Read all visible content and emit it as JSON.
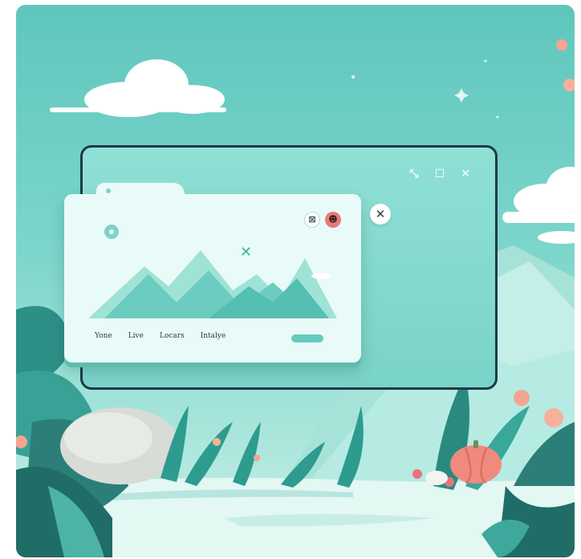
{
  "window": {
    "controls": {
      "minimize_icon": "arrow-collapse-icon",
      "maximize_icon": "square-icon",
      "close_icon": "close-icon",
      "minimize_glyph": "⤡",
      "maximize_glyph": "☐",
      "close_glyph": "✕"
    }
  },
  "card": {
    "nav": [
      "Yone",
      "Live",
      "Locars",
      "Intalye"
    ],
    "minimize_glyph": "⊠",
    "profile_glyph": "☻",
    "close_glyph": "✕",
    "x_glyph": "✕"
  },
  "colors": {
    "background_teal": "#5fc6bd",
    "card_surface": "#e9fbf8",
    "accent_teal": "#66c9bd",
    "window_border": "#1d3a4a",
    "coral": "#e87a78",
    "pumpkin": "#f08a7c"
  }
}
